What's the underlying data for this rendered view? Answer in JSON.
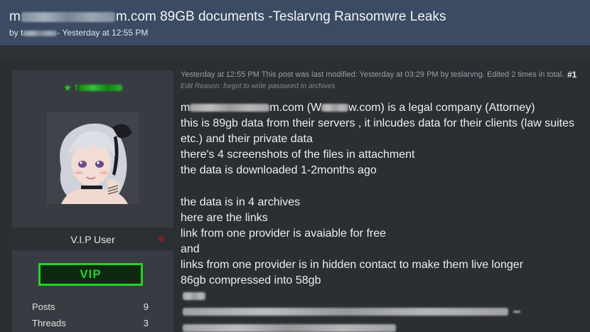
{
  "thread": {
    "title_prefix": "m",
    "title_suffix": "m.com 89GB documents -Teslarvng Ransomwre Leaks",
    "by_label": "by t",
    "by_suffix": "- Yesterday at 12:55 PM"
  },
  "sidebar": {
    "username_prefix": "t",
    "role": "V.I.P User",
    "badge": "VIP",
    "stats": [
      {
        "label": "Posts",
        "value": "9"
      },
      {
        "label": "Threads",
        "value": "3"
      }
    ]
  },
  "post": {
    "meta": "Yesterday at 12:55 PM  This post was last modified: Yesterday at 03:29 PM by teslarvng. Edited 2 times in total.",
    "number": "#1",
    "edit_reason": "Edit Reason: forgot to write password to archives",
    "line1_a": "m",
    "line1_b": "m.com (W",
    "line1_c": "w.com) is a legal company (Attorney)",
    "lines": [
      "this is 89gb data from their servers , it inlcudes data for their clients (law suites",
      "etc.) and their private data",
      "there's 4 screenshots of the files in attachment",
      "the data is downloaded 1-2months ago",
      "",
      "the data is in 4 archives",
      "here are the links",
      "link from one provider is avaiable for free",
      "and",
      "links from one provider is in hidden contact to make them live longer",
      "86gb compressed into 58gb"
    ]
  },
  "colors": {
    "header_bg": "#3a4b63",
    "page_bg": "#2b2e33",
    "sidebar_bg": "#383c42",
    "username_green": "#25c52a",
    "vip_green": "#27cf2d"
  }
}
